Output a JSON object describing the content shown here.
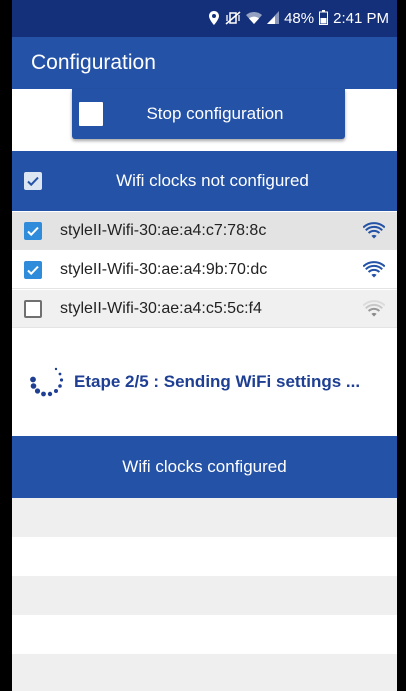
{
  "status_bar": {
    "location_icon": "location-pin-icon",
    "mute_icon": "vibrate-mute-icon",
    "wifi_icon": "wifi-status-icon",
    "signal_icon": "cell-signal-icon",
    "battery_percent": "48%",
    "battery_icon": "battery-icon",
    "time": "2:41 PM"
  },
  "app_bar": {
    "title": "Configuration"
  },
  "stop_button": {
    "label": "Stop configuration"
  },
  "not_configured": {
    "header_label": "Wifi clocks not configured",
    "header_checked": true,
    "devices": [
      {
        "name": "styleII-Wifi-30:ae:a4:c7:78:8c",
        "checked": true,
        "signal": "strong"
      },
      {
        "name": "styleII-Wifi-30:ae:a4:9b:70:dc",
        "checked": true,
        "signal": "strong"
      },
      {
        "name": "styleII-Wifi-30:ae:a4:c5:5c:f4",
        "checked": false,
        "signal": "weak"
      }
    ]
  },
  "progress": {
    "text": "Etape 2/5 : Sending WiFi settings ..."
  },
  "configured": {
    "header_label": "Wifi clocks configured"
  },
  "colors": {
    "status_bar": "#15307a",
    "primary": "#2452a6",
    "checkbox_on": "#2e8cdb",
    "progress_text": "#1f3f93",
    "wifi_strong": "#2452a6",
    "wifi_weak": "#9a9a9a"
  }
}
